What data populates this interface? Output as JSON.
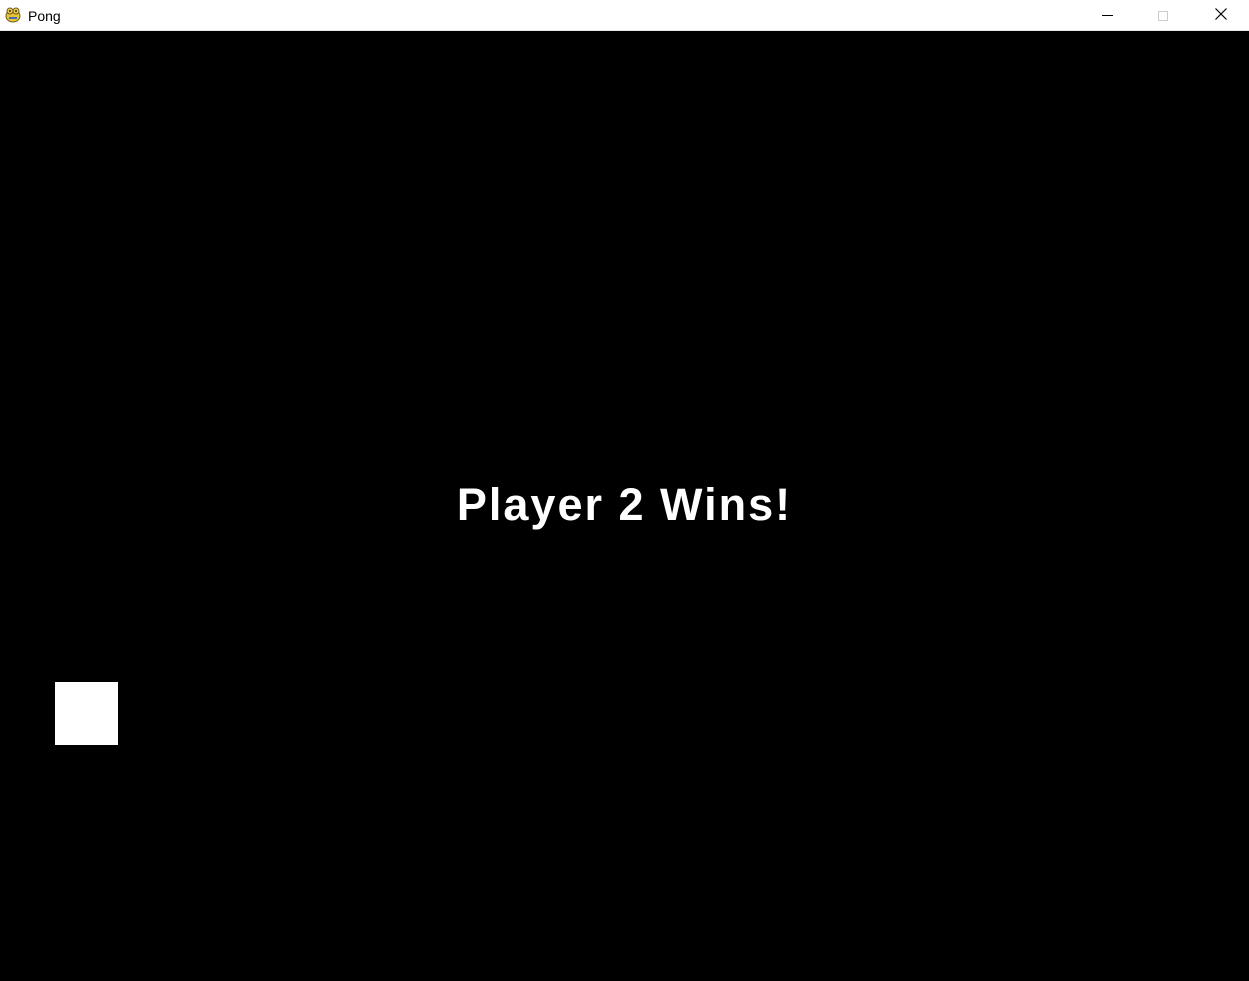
{
  "window": {
    "title": "Pong",
    "icon": "pygame-snake-icon",
    "controls": {
      "minimize": "minimize-icon",
      "maximize": "maximize-icon",
      "close": "close-icon"
    }
  },
  "game": {
    "background_color": "#000000",
    "foreground_color": "#ffffff",
    "message": "Player 2 Wins!"
  }
}
